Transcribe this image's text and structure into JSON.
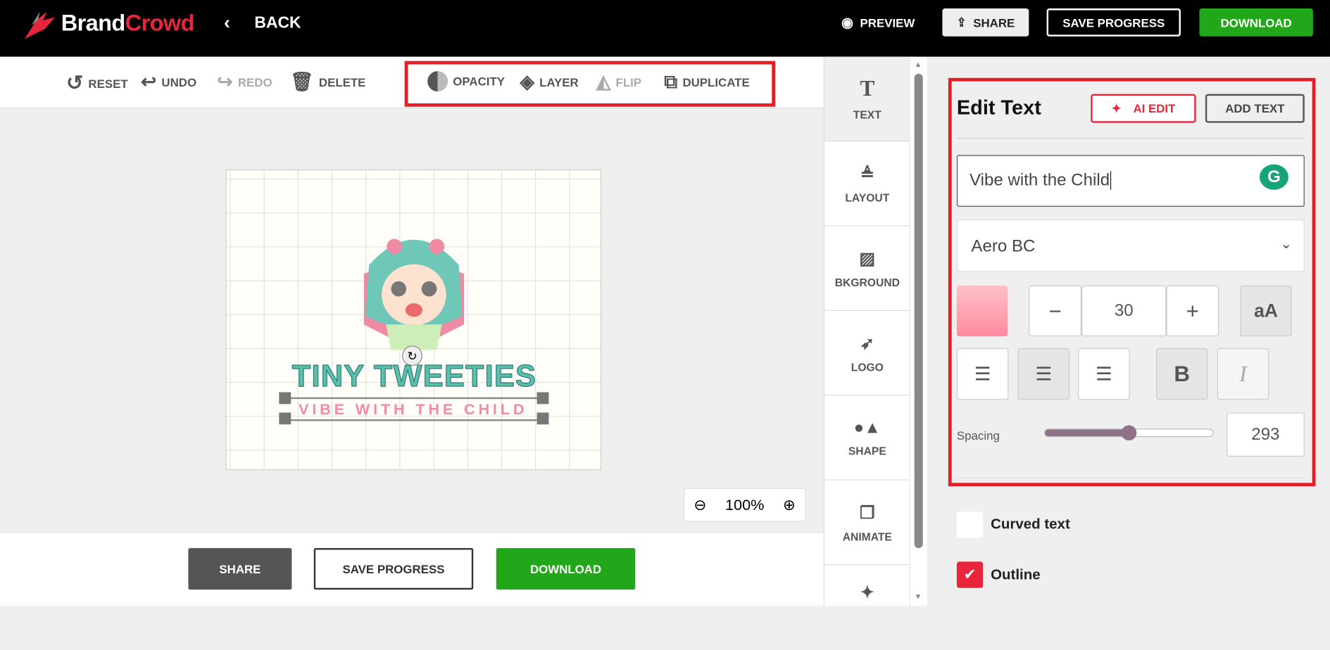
{
  "header": {
    "brand_part1": "Brand",
    "brand_part2": "Crowd",
    "back": "BACK",
    "preview": "PREVIEW",
    "share": "SHARE",
    "save_progress": "SAVE PROGRESS",
    "download": "DOWNLOAD"
  },
  "toolbar": {
    "reset": "RESET",
    "undo": "UNDO",
    "redo": "REDO",
    "delete": "DELETE",
    "opacity": "OPACITY",
    "layer": "LAYER",
    "flip": "FLIP",
    "duplicate": "DUPLICATE"
  },
  "design": {
    "title": "TINY TWEETIES",
    "tagline": "VIBE WITH THE CHILD"
  },
  "zoom": {
    "level": "100%"
  },
  "bottom": {
    "share": "SHARE",
    "save_progress": "SAVE PROGRESS",
    "download": "DOWNLOAD"
  },
  "sidenav": [
    {
      "label": "TEXT"
    },
    {
      "label": "LAYOUT"
    },
    {
      "label": "BKGROUND"
    },
    {
      "label": "LOGO"
    },
    {
      "label": "SHAPE"
    },
    {
      "label": "ANIMATE"
    }
  ],
  "panel": {
    "title": "Edit Text",
    "ai_edit": "AI EDIT",
    "add_text": "ADD TEXT",
    "text_value": "Vibe with the Child",
    "font": "Aero BC",
    "font_size": "30",
    "minus": "−",
    "plus": "+",
    "case": "aA",
    "bold": "B",
    "italic": "I",
    "spacing_label": "Spacing",
    "spacing_value": "293",
    "spacing_fraction": 0.5,
    "curved_text": "Curved text",
    "outline": "Outline",
    "curved_checked": false,
    "outline_checked": true
  },
  "colors": {
    "accent": "#e8253a",
    "green": "#22a61a",
    "text_color": "#ff8fa3"
  }
}
